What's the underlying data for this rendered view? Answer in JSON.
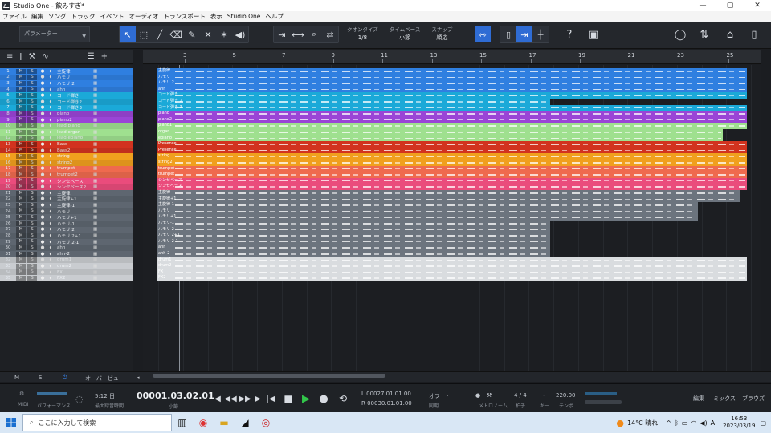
{
  "window": {
    "title": "Studio One - 飲みすぎ*",
    "controls": [
      "—",
      "▢",
      "✕"
    ]
  },
  "menu": [
    "ファイル",
    "編集",
    "ソング",
    "トラック",
    "イベント",
    "オーディオ",
    "トランスポート",
    "表示",
    "Studio One",
    "ヘルプ"
  ],
  "toolbar": {
    "param_label": "パラメーター",
    "quantize": {
      "label": "クオンタイズ",
      "value": "1/8"
    },
    "timebase": {
      "label": "タイムベース",
      "value": "小節"
    },
    "snap": {
      "label": "スナップ",
      "value": "順応"
    }
  },
  "tracks": [
    {
      "n": "1",
      "name": "主旋律",
      "color": "#2f7fe0"
    },
    {
      "n": "2",
      "name": "ハモリ",
      "color": "#2f7fe0"
    },
    {
      "n": "3",
      "name": "ハモリ 2",
      "color": "#2f7fe0"
    },
    {
      "n": "4",
      "name": "ahh",
      "color": "#2f7fe0"
    },
    {
      "n": "5",
      "name": "コード弾き",
      "color": "#1ba9d8"
    },
    {
      "n": "6",
      "name": "コード弾き2",
      "color": "#1ba9d8"
    },
    {
      "n": "7",
      "name": "コード弾き3",
      "color": "#1ba9d8"
    },
    {
      "n": "8",
      "name": "piano",
      "color": "#9a45d6"
    },
    {
      "n": "9",
      "name": "piano2",
      "color": "#9a45d6"
    },
    {
      "n": "10",
      "name": "lead piano",
      "color": "#9fe08f"
    },
    {
      "n": "11",
      "name": "lead organ",
      "color": "#9fe08f"
    },
    {
      "n": "12",
      "name": "lead epiano",
      "color": "#9fe08f"
    },
    {
      "n": "13",
      "name": "Bass",
      "color": "#d2331f"
    },
    {
      "n": "14",
      "name": "Bass2",
      "color": "#d2331f"
    },
    {
      "n": "15",
      "name": "string",
      "color": "#f0a01e"
    },
    {
      "n": "16",
      "name": "string2",
      "color": "#f0a01e"
    },
    {
      "n": "17",
      "name": "trumpet",
      "color": "#ef6a4e"
    },
    {
      "n": "18",
      "name": "trumpet2",
      "color": "#ef6a4e"
    },
    {
      "n": "19",
      "name": "シンセベース",
      "color": "#ea4c7c"
    },
    {
      "n": "20",
      "name": "シンセベース2",
      "color": "#ea4c7c"
    },
    {
      "n": "21",
      "name": "主旋律",
      "color": "#5e6670"
    },
    {
      "n": "22",
      "name": "主旋律+1",
      "color": "#5e6670"
    },
    {
      "n": "23",
      "name": "主旋律-1",
      "color": "#5e6670"
    },
    {
      "n": "24",
      "name": "ハモリ",
      "color": "#5e6670"
    },
    {
      "n": "25",
      "name": "ハモリ+1",
      "color": "#5e6670"
    },
    {
      "n": "26",
      "name": "ハモリ-1",
      "color": "#5e6670"
    },
    {
      "n": "27",
      "name": "ハモリ 2",
      "color": "#5e6670"
    },
    {
      "n": "28",
      "name": "ハモリ 2+1",
      "color": "#5e6670"
    },
    {
      "n": "29",
      "name": "ハモリ 2-1",
      "color": "#5e6670"
    },
    {
      "n": "30",
      "name": "ahh",
      "color": "#5e6670"
    },
    {
      "n": "31",
      "name": "ahh-2",
      "color": "#5e6670"
    },
    {
      "n": "32",
      "name": "drum1",
      "color": "#c9ccd0"
    },
    {
      "n": "33",
      "name": "drum2",
      "color": "#c9ccd0"
    },
    {
      "n": "34",
      "name": "FX",
      "color": "#c9ccd0"
    },
    {
      "n": "35",
      "name": "FX2",
      "color": "#c9ccd0"
    }
  ],
  "clips": [
    {
      "label": "主旋律",
      "color": "#2f7fe0"
    },
    {
      "label": "ハモリ",
      "color": "#2f7fe0"
    },
    {
      "label": "ハモリ 2",
      "color": "#2f7fe0"
    },
    {
      "label": "ahh",
      "color": "#2f7fe0"
    },
    {
      "label": "コード弾き",
      "color": "#1ba9d8"
    },
    {
      "label": "コード弾き 2",
      "color": "#1ba9d8"
    },
    {
      "label": "コード弾き 3",
      "color": "#1ba9d8"
    },
    {
      "label": "piano",
      "color": "#9a45d6"
    },
    {
      "label": "piano2",
      "color": "#9a45d6"
    },
    {
      "label": "piano1",
      "color": "#9fe08f"
    },
    {
      "label": "organ",
      "color": "#9fe08f"
    },
    {
      "label": "epiano",
      "color": "#9fe08f"
    },
    {
      "label": "Presence",
      "color": "#d2331f"
    },
    {
      "label": "Presence",
      "color": "#d2331f"
    },
    {
      "label": "string",
      "color": "#f0a01e"
    },
    {
      "label": "string2",
      "color": "#f0a01e"
    },
    {
      "label": "trumpet",
      "color": "#ef6a4e"
    },
    {
      "label": "trumpet",
      "color": "#ef6a4e"
    },
    {
      "label": "シンセベース",
      "color": "#ea4c7c"
    },
    {
      "label": "シンセベース",
      "color": "#ea4c7c"
    },
    {
      "label": "主旋律",
      "color": "#6c747e"
    },
    {
      "label": "主旋律+1",
      "color": "#6c747e"
    },
    {
      "label": "主旋律-1",
      "color": "#6c747e"
    },
    {
      "label": "ハモリ",
      "color": "#6c747e"
    },
    {
      "label": "ハモリ+1",
      "color": "#6c747e"
    },
    {
      "label": "ハモリ-1",
      "color": "#6c747e"
    },
    {
      "label": "ハモリ 2",
      "color": "#6c747e"
    },
    {
      "label": "ハモリ 2+1",
      "color": "#6c747e"
    },
    {
      "label": "ハモリ 2-1",
      "color": "#6c747e"
    },
    {
      "label": "ahh",
      "color": "#6c747e"
    },
    {
      "label": "ahh-2",
      "color": "#6c747e"
    },
    {
      "label": "drum1",
      "color": "#d9dcdf"
    },
    {
      "label": "drum2",
      "color": "#d9dcdf"
    },
    {
      "label": "FX",
      "color": "#d9dcdf"
    },
    {
      "label": "FX2",
      "color": "#d9dcdf"
    }
  ],
  "ruler": [
    "3",
    "5",
    "7",
    "9",
    "11",
    "13",
    "15",
    "17",
    "19",
    "21",
    "23",
    "25"
  ],
  "lower": {
    "m": "M",
    "s": "S",
    "overview": "オーバービュー"
  },
  "transport": {
    "midi": "MIDI",
    "performance": "パフォーマンス",
    "record_days": "5:12 日",
    "record_label": "最大録音時間",
    "position": "00001.03.02.01",
    "position_unit": "小節",
    "loop_l": "L  00027.01.01.00",
    "loop_r": "R  00030.01.01.00",
    "sync_label": "オフ",
    "sync_sub": "同期",
    "metronome_label": "メトロノーム",
    "timesig": "4 / 4",
    "timesig_label": "拍子",
    "key_label": "キー",
    "key_value": "-",
    "tempo": "220.00",
    "tempo_label": "テンポ",
    "tabs": [
      "編集",
      "ミックス",
      "ブラウズ"
    ]
  },
  "taskbar": {
    "search_placeholder": "ここに入力して検索",
    "weather": "14°C 晴れ",
    "time": "16:53",
    "date": "2023/03/19"
  }
}
